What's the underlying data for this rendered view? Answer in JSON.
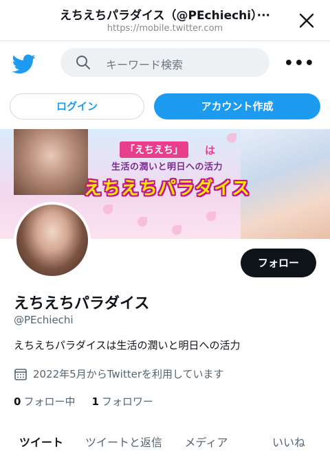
{
  "browser": {
    "title": "えちえちパラダイス（@PEchiechi）···",
    "url": "https://mobile.twitter.com"
  },
  "nav": {
    "search_placeholder": "キーワード検索",
    "more": "•••"
  },
  "auth": {
    "login_label": "ログイン",
    "signup_label": "アカウント作成"
  },
  "banner": {
    "small_text": "「えちえち」",
    "small_suffix": "は",
    "middle_text": "生活の潤いと明日への活力",
    "big_text": "えちえちパラダイス"
  },
  "profile": {
    "follow_label": "フォロー",
    "name": "えちえちパラダイス",
    "handle": "@PEchiechi",
    "bio": "えちえちパラダイスは生活の潤いと明日への活力",
    "joined": "2022年5月からTwitterを利用しています",
    "following_count": "0",
    "following_label": "フォロー中",
    "followers_count": "1",
    "followers_label": "フォロワー"
  },
  "tabs": [
    {
      "label": "ツイート"
    },
    {
      "label": "ツイートと返信"
    },
    {
      "label": "メディア"
    },
    {
      "label": "いいね"
    }
  ],
  "colors": {
    "brand_blue": "#1d9bf0",
    "dark": "#0f1419",
    "muted": "#536471"
  }
}
